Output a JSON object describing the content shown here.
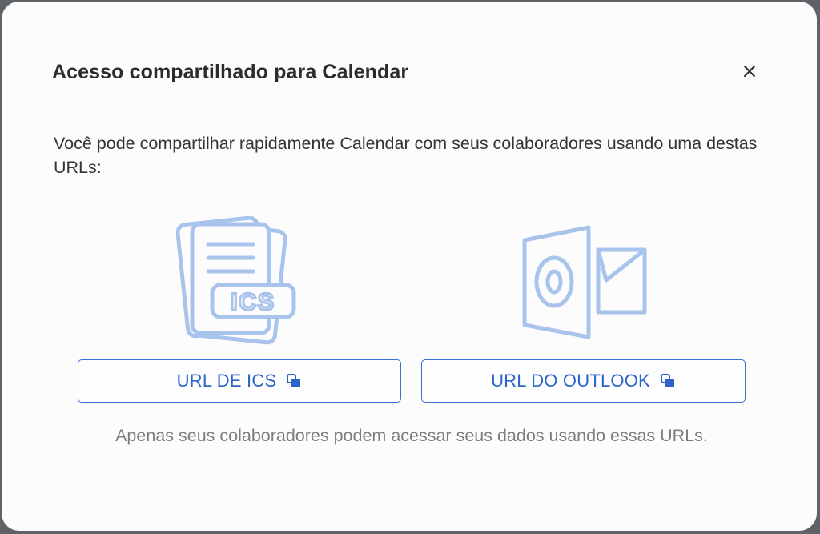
{
  "dialog": {
    "title": "Acesso compartilhado para Calendar",
    "close_icon": "close-icon",
    "description": "Você pode compartilhar rapidamente Calendar com seus colaboradores usando uma destas URLs:",
    "illustrations": {
      "ics_label": "ICS",
      "ics_icon": "ics-file-icon",
      "outlook_icon": "outlook-icon"
    },
    "buttons": {
      "ics_label": "URL DE ICS",
      "outlook_label": "URL DO OUTLOOK",
      "copy_icon": "copy-icon"
    },
    "footnote": "Apenas seus colaboradores podem acessar seus dados usando essas URLs."
  },
  "colors": {
    "accent": "#3a6fd4",
    "illustration": "#a9c4ec",
    "title_text": "#2b2b2e",
    "muted_text": "#7c7d80",
    "background": "#fcfcfd"
  }
}
